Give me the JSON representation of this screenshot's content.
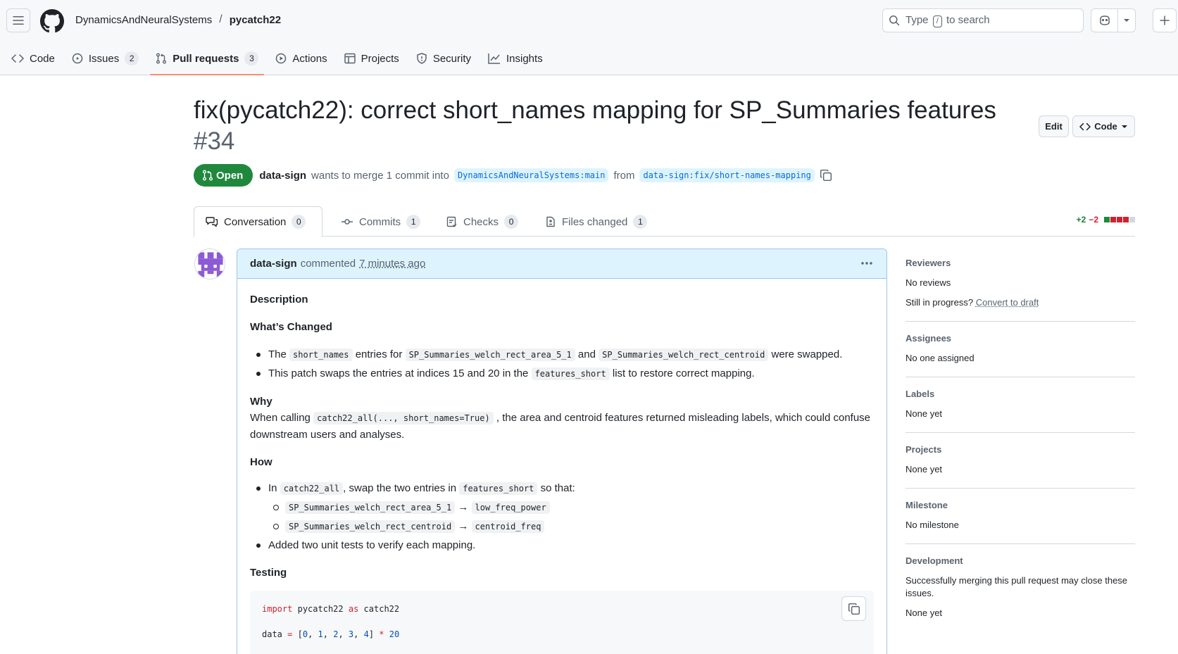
{
  "header": {
    "owner": "DynamicsAndNeuralSystems",
    "separator": "/",
    "repo": "pycatch22",
    "search": {
      "prefix": "Type",
      "key": "/",
      "suffix": "to search"
    }
  },
  "nav": {
    "code": "Code",
    "issues": "Issues",
    "issues_count": "2",
    "pulls": "Pull requests",
    "pulls_count": "3",
    "actions": "Actions",
    "projects": "Projects",
    "security": "Security",
    "insights": "Insights"
  },
  "pr": {
    "title": "fix(pycatch22): correct short_names mapping for SP_Summaries features",
    "number": "#34",
    "edit_label": "Edit",
    "code_label": "Code",
    "state": "Open",
    "author": "data-sign",
    "merge_text": "wants to merge 1 commit into",
    "base_branch": "DynamicsAndNeuralSystems:main",
    "from_text": "from",
    "head_branch": "data-sign:fix/short-names-mapping"
  },
  "tabs": {
    "conversation": "Conversation",
    "conversation_count": "0",
    "commits": "Commits",
    "commits_count": "1",
    "checks": "Checks",
    "checks_count": "0",
    "files": "Files changed",
    "files_count": "1",
    "additions": "+2",
    "deletions": "−2",
    "diff_colors": [
      "#1f883d",
      "#cf222e",
      "#cf222e",
      "#cf222e",
      "#d1d9e0"
    ]
  },
  "comment": {
    "author": "data-sign",
    "verb": "commented",
    "time": "7 minutes ago",
    "description_heading": "Description",
    "changed_heading": "What’s Changed",
    "changed_1_a": "The",
    "changed_1_code1": "short_names",
    "changed_1_b": "entries for",
    "changed_1_code2": "SP_Summaries_welch_rect_area_5_1",
    "changed_1_c": "and",
    "changed_1_code3": "SP_Summaries_welch_rect_centroid",
    "changed_1_d": "were swapped.",
    "changed_2_a": "This patch swaps the entries at indices 15 and 20 in the",
    "changed_2_code": "features_short",
    "changed_2_b": "list to restore correct mapping.",
    "why_heading": "Why",
    "why_a": "When calling",
    "why_code": "catch22_all(..., short_names=True)",
    "why_b": ", the area and centroid features returned misleading labels, which could confuse downstream users and analyses.",
    "how_heading": "How",
    "how_1_a": "In",
    "how_1_code1": "catch22_all",
    "how_1_b": ", swap the two entries in",
    "how_1_code2": "features_short",
    "how_1_c": "so that:",
    "map_1_from": "SP_Summaries_welch_rect_area_5_1",
    "map_1_arrow": "→",
    "map_1_to": "low_freq_power",
    "map_2_from": "SP_Summaries_welch_rect_centroid",
    "map_2_arrow": "→",
    "map_2_to": "centroid_freq",
    "how_2": "Added two unit tests to verify each mapping.",
    "testing_heading": "Testing",
    "code_line1_kw1": "import",
    "code_line1_mod": "pycatch22",
    "code_line1_kw2": "as",
    "code_line1_alias": "catch22",
    "code_line2_var": "data",
    "code_line2_eq": "=",
    "code_line2_open": "[",
    "code_line2_n0": "0",
    "code_line2_n1": "1",
    "code_line2_n2": "2",
    "code_line2_n3": "3",
    "code_line2_n4": "4",
    "code_line2_close": "]",
    "code_line2_mul": "*",
    "code_line2_n20": "20"
  },
  "sidebar": {
    "reviewers_h": "Reviewers",
    "reviewers_v": "No reviews",
    "progress_q": "Still in progress?",
    "progress_link": "Convert to draft",
    "assignees_h": "Assignees",
    "assignees_v": "No one assigned",
    "labels_h": "Labels",
    "labels_v": "None yet",
    "projects_h": "Projects",
    "projects_v": "None yet",
    "milestone_h": "Milestone",
    "milestone_v": "No milestone",
    "development_h": "Development",
    "development_t": "Successfully merging this pull request may close these issues.",
    "development_v": "None yet"
  },
  "colors": {
    "accent": "#0969da",
    "open_green": "#1f883d",
    "nav_underline": "#fd8c73",
    "comment_header": "#ddf4ff"
  }
}
